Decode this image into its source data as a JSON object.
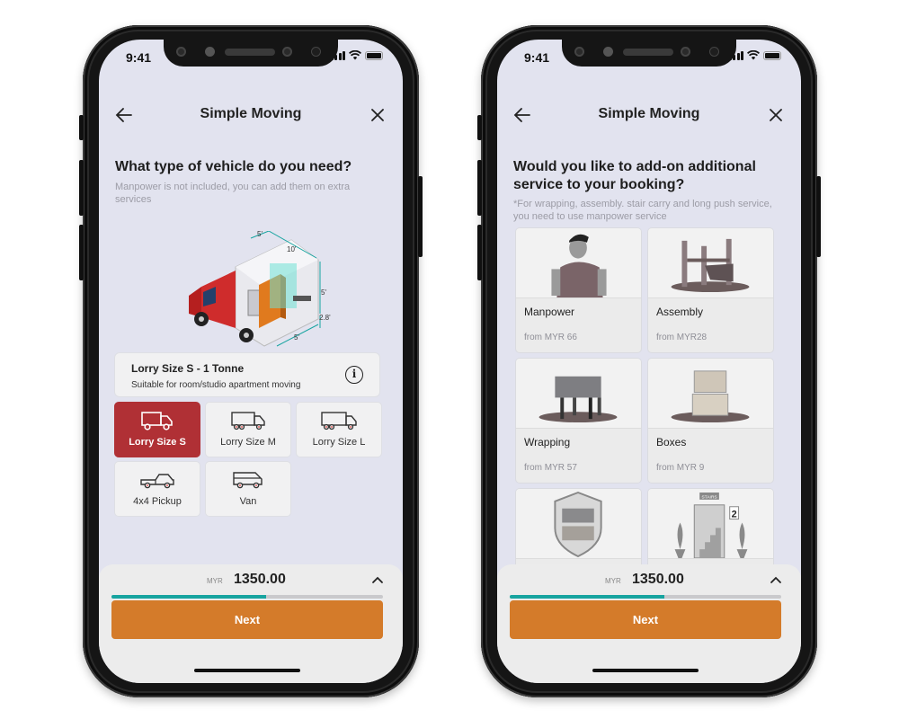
{
  "colors": {
    "accent_red": "#b03035",
    "progress_teal": "#17a4a0",
    "next_orange": "#d47b2a",
    "screen_bg": "#e2e3ef"
  },
  "phones": [
    {
      "status": {
        "time": "9:41"
      },
      "nav": {
        "title": "Simple Moving",
        "back_icon": "arrow-left-icon",
        "close_icon": "close-icon"
      },
      "heading": "What type of vehicle do you need?",
      "subtext": "Manpower is not included, you can add them on extra services",
      "illustration": {
        "name": "lorry-dimensions-illustration",
        "labels": [
          "5'",
          "10'",
          "5'",
          "2.8'",
          "5'"
        ]
      },
      "selected_vehicle": {
        "title": "Lorry Size S - 1 Tonne",
        "description": "Suitable for room/studio apartment moving",
        "info_icon": "info-icon"
      },
      "vehicles": [
        {
          "label": "Lorry Size S",
          "icon": "truck-small-icon",
          "selected": true
        },
        {
          "label": "Lorry Size M",
          "icon": "truck-medium-icon",
          "selected": false
        },
        {
          "label": "Lorry Size L",
          "icon": "truck-large-icon",
          "selected": false
        },
        {
          "label": "4x4 Pickup",
          "icon": "pickup-icon",
          "selected": false
        },
        {
          "label": "Van",
          "icon": "van-icon",
          "selected": false
        }
      ],
      "footer": {
        "currency": "MYR",
        "amount": "1350.00",
        "progress": 0.57,
        "next_label": "Next"
      }
    },
    {
      "status": {
        "time": "9:41"
      },
      "nav": {
        "title": "Simple Moving",
        "back_icon": "arrow-left-icon",
        "close_icon": "close-icon"
      },
      "heading": "Would you like to add-on additional service to your booking?",
      "subtext": "*For wrapping, assembly. stair carry and long push service, you need to use manpower service",
      "services": [
        {
          "name": "Manpower",
          "price": "from MYR 66",
          "icon": "manpower-illustration"
        },
        {
          "name": "Assembly",
          "price": "from MYR28",
          "icon": "assembly-illustration"
        },
        {
          "name": "Wrapping",
          "price": "from MYR 57",
          "icon": "wrapping-illustration"
        },
        {
          "name": "Boxes",
          "price": "from MYR 9",
          "icon": "boxes-illustration"
        },
        {
          "name": "",
          "price": "",
          "icon": "insurance-shield-illustration"
        },
        {
          "name": "",
          "price": "",
          "icon": "stair-carry-illustration",
          "badge_text": "STAIRS",
          "level": "2"
        }
      ],
      "footer": {
        "currency": "MYR",
        "amount": "1350.00",
        "progress": 0.57,
        "next_label": "Next"
      }
    }
  ]
}
